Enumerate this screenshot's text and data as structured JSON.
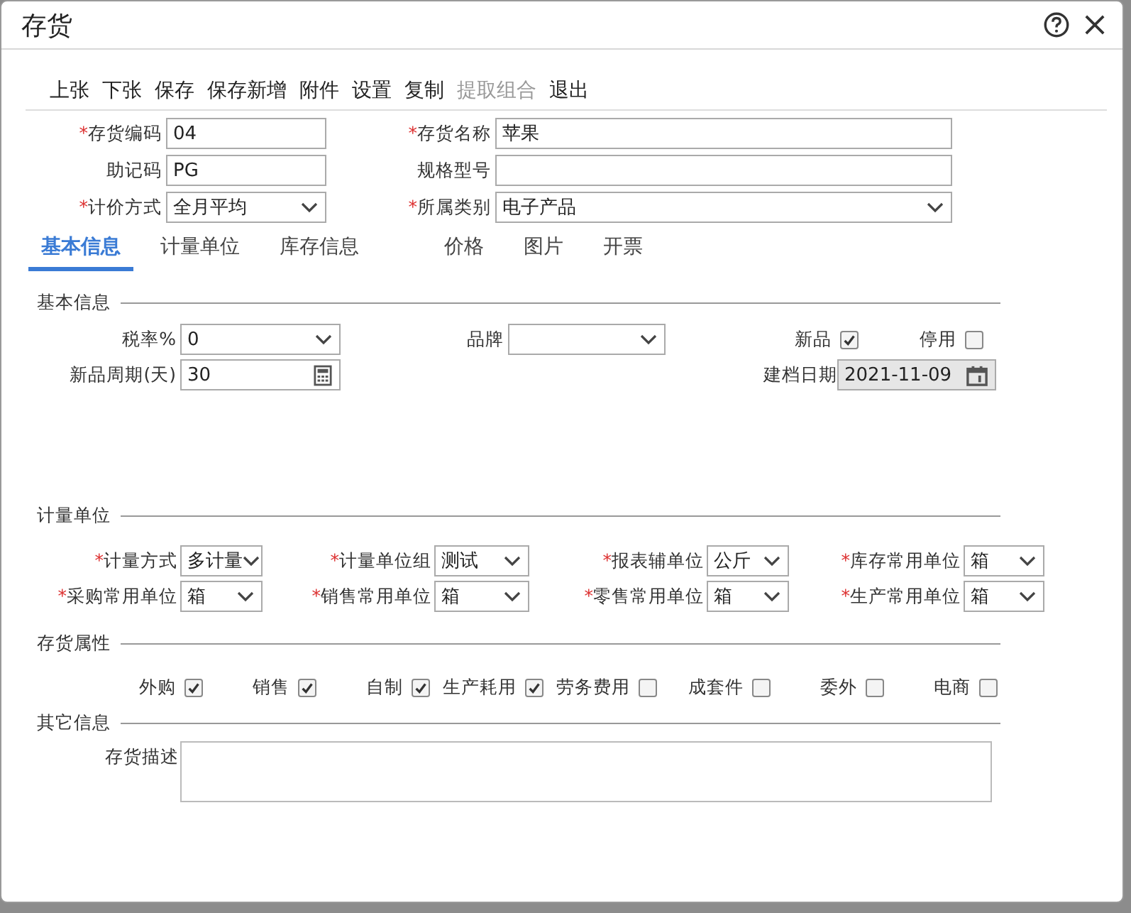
{
  "window": {
    "title": "存货"
  },
  "toolbar": [
    {
      "label": "上张",
      "disabled": false
    },
    {
      "label": "下张",
      "disabled": false
    },
    {
      "label": "保存",
      "disabled": false
    },
    {
      "label": "保存新增",
      "disabled": false
    },
    {
      "label": "附件",
      "disabled": false
    },
    {
      "label": "设置",
      "disabled": false
    },
    {
      "label": "复制",
      "disabled": false
    },
    {
      "label": "提取组合",
      "disabled": true
    },
    {
      "label": "退出",
      "disabled": false
    }
  ],
  "header_fields": [
    {
      "marker": "*",
      "label": "存货编码",
      "kind": "text",
      "value": "04"
    },
    {
      "marker": "*",
      "label": "存货名称",
      "kind": "text",
      "value": "苹果"
    },
    {
      "label": "助记码",
      "kind": "text",
      "value": "PG"
    },
    {
      "label": "规格型号",
      "kind": "text"
    },
    {
      "marker": "*",
      "label": "计价方式",
      "kind": "select",
      "value": "全月平均"
    },
    {
      "marker": "*",
      "label": "所属类别",
      "kind": "select",
      "value": "电子产品"
    }
  ],
  "tabs": [
    {
      "label": "基本信息",
      "selected": true
    },
    {
      "label": "计量单位",
      "selected": false
    },
    {
      "label": "库存信息",
      "selected": false
    },
    {
      "label": "价格",
      "selected": false
    },
    {
      "label": "图片",
      "selected": false
    },
    {
      "label": "开票",
      "selected": false
    }
  ],
  "basic_info": {
    "title": "基本信息",
    "fields": [
      {
        "label": "税率%",
        "kind": "select",
        "value": "0"
      },
      {
        "label": "品牌",
        "kind": "select"
      },
      {
        "label": "新品",
        "kind": "checkbox",
        "checked": true
      },
      {
        "label": "停用",
        "kind": "checkbox",
        "checked": false
      },
      {
        "label": "新品周期(天)",
        "kind": "number",
        "value": "30"
      },
      {
        "label": "建档日期",
        "kind": "date",
        "value": "2021-11-09",
        "disabled": true
      }
    ]
  },
  "units": {
    "title": "计量单位",
    "fields": [
      {
        "marker": "*",
        "label": "计量方式",
        "value": "多计量"
      },
      {
        "marker": "*",
        "label": "计量单位组",
        "value": "测试"
      },
      {
        "marker": "*",
        "label": "报表辅单位",
        "value": "公斤"
      },
      {
        "marker": "*",
        "label": "库存常用单位",
        "value": "箱"
      },
      {
        "marker": "*",
        "label": "采购常用单位",
        "value": "箱"
      },
      {
        "marker": "*",
        "label": "销售常用单位",
        "value": "箱"
      },
      {
        "marker": "*",
        "label": "零售常用单位",
        "value": "箱"
      },
      {
        "marker": "*",
        "label": "生产常用单位",
        "value": "箱"
      }
    ]
  },
  "attributes": {
    "title": "存货属性",
    "items": [
      {
        "label": "外购",
        "checked": true
      },
      {
        "label": "销售",
        "checked": true
      },
      {
        "label": "自制",
        "checked": true
      },
      {
        "label": "生产耗用",
        "checked": true
      },
      {
        "label": "劳务费用",
        "checked": false
      },
      {
        "label": "成套件",
        "checked": false
      },
      {
        "label": "委外",
        "checked": false
      },
      {
        "label": "电商",
        "checked": false
      }
    ]
  },
  "other_info": {
    "title": "其它信息",
    "description": {
      "label": "存货描述"
    }
  }
}
